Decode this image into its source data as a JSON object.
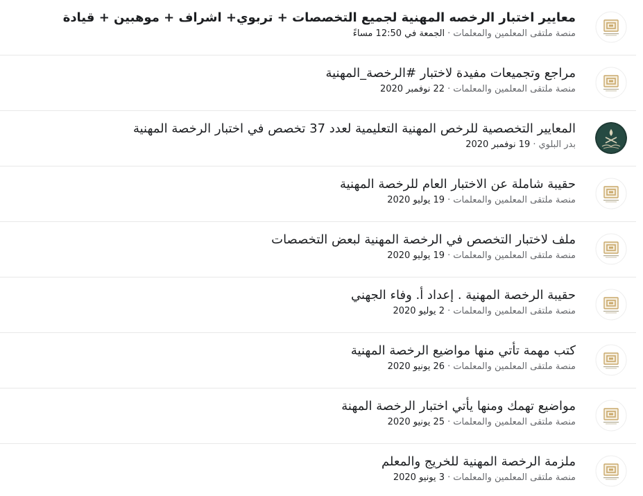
{
  "colors": {
    "title": "#1c1e21",
    "meta": "#65676b",
    "divider": "#e8e8e8",
    "logo_gold": "#c9a86a",
    "logo_cream": "#f6efe0",
    "avatar_dark": "#1f3a34"
  },
  "posts": [
    {
      "title": "معايير اختبار الرخصه المهنية لجميع التخصصات + تربوي+ اشراف + موهبين + قيادة",
      "bold": true,
      "source": "منصة ملتقى المعلمين والمعلمات",
      "separator": "·",
      "date": "الجمعة في 12:50 مساءً",
      "avatar": "gold-logo-icon"
    },
    {
      "title": "مراجع وتجميعات مفيدة لاختبار #الرخصة_المهنية",
      "bold": false,
      "source": "منصة ملتقى المعلمين والمعلمات",
      "separator": "·",
      "date": "22 نوفمبر 2020",
      "avatar": "gold-logo-icon"
    },
    {
      "title": "المعايير التخصصية للرخص المهنية التعليمية لعدد 37 تخصص في اختبار الرخصة المهنية",
      "bold": false,
      "source": "بدر البلوي",
      "separator": "·",
      "date": "19 نوفمبر 2020",
      "avatar": "emblem-icon"
    },
    {
      "title": "حقيبة شاملة عن الاختبار العام للرخصة المهنية",
      "bold": false,
      "source": "منصة ملتقى المعلمين والمعلمات",
      "separator": "·",
      "date": "19 يوليو 2020",
      "avatar": "gold-logo-icon"
    },
    {
      "title": "ملف لاختبار التخصص في الرخصة المهنية لبعض التخصصات",
      "bold": false,
      "source": "منصة ملتقى المعلمين والمعلمات",
      "separator": "·",
      "date": "19 يوليو 2020",
      "avatar": "gold-logo-icon"
    },
    {
      "title": "حقيبة الرخصة المهنية . إعداد أ. وفاء الجهني",
      "bold": false,
      "source": "منصة ملتقى المعلمين والمعلمات",
      "separator": "·",
      "date": "2 يوليو 2020",
      "avatar": "gold-logo-icon"
    },
    {
      "title": "كتب مهمة تأتي منها مواضيع الرخصة المهنية",
      "bold": false,
      "source": "منصة ملتقى المعلمين والمعلمات",
      "separator": "·",
      "date": "26 يونيو 2020",
      "avatar": "gold-logo-icon"
    },
    {
      "title": "مواضيع تهمك ومنها يأتي اختبار الرخصة المهنة",
      "bold": false,
      "source": "منصة ملتقى المعلمين والمعلمات",
      "separator": "·",
      "date": "25 يونيو 2020",
      "avatar": "gold-logo-icon"
    },
    {
      "title": "ملزمة الرخصة المهنية للخريج والمعلم",
      "bold": false,
      "source": "منصة ملتقى المعلمين والمعلمات",
      "separator": "·",
      "date": "3 يونيو 2020",
      "avatar": "gold-logo-icon"
    }
  ]
}
